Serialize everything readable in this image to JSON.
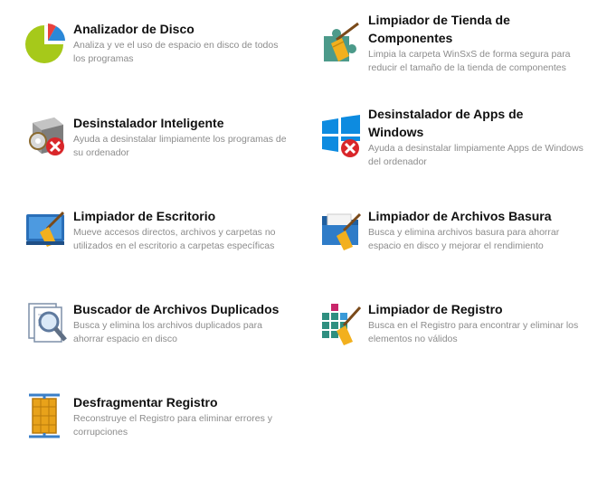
{
  "tools": [
    {
      "title": "Analizador de Disco",
      "description": "Analiza y ve el uso de espacio en disco de todos los programas",
      "icon": "pie-chart-icon"
    },
    {
      "title": "Limpiador de Tienda de Componentes",
      "description": "Limpia la carpeta WinSxS de forma segura para reducir el tamaño de la tienda de componentes",
      "icon": "puzzle-broom-icon"
    },
    {
      "title": "Desinstalador Inteligente",
      "description": "Ayuda a desinstalar limpiamente los programas de su ordenador",
      "icon": "uninstall-box-icon"
    },
    {
      "title": "Desinstalador de Apps de Windows",
      "description": "Ayuda a desinstalar limpiamente Apps de Windows del ordenador",
      "icon": "windows-logo-icon"
    },
    {
      "title": "Limpiador de Escritorio",
      "description": "Mueve accesos directos, archivos y carpetas no utilizados en el escritorio a carpetas específicas",
      "icon": "desktop-broom-icon"
    },
    {
      "title": "Limpiador de Archivos Basura",
      "description": "Busca y elimina archivos basura para ahorrar espacio en disco y mejorar el rendimiento",
      "icon": "folder-broom-icon"
    },
    {
      "title": "Buscador de Archivos Duplicados",
      "description": "Busca y elimina los archivos duplicados para ahorrar espacio en disco",
      "icon": "magnifier-document-icon"
    },
    {
      "title": "Limpiador de Registro",
      "description": "Busca en el Registro para encontrar y eliminar los elementos no válidos",
      "icon": "registry-broom-icon"
    },
    {
      "title": "Desfragmentar Registro",
      "description": "Reconstruye el Registro para eliminar errores y corrupciones",
      "icon": "registry-compress-icon"
    }
  ]
}
